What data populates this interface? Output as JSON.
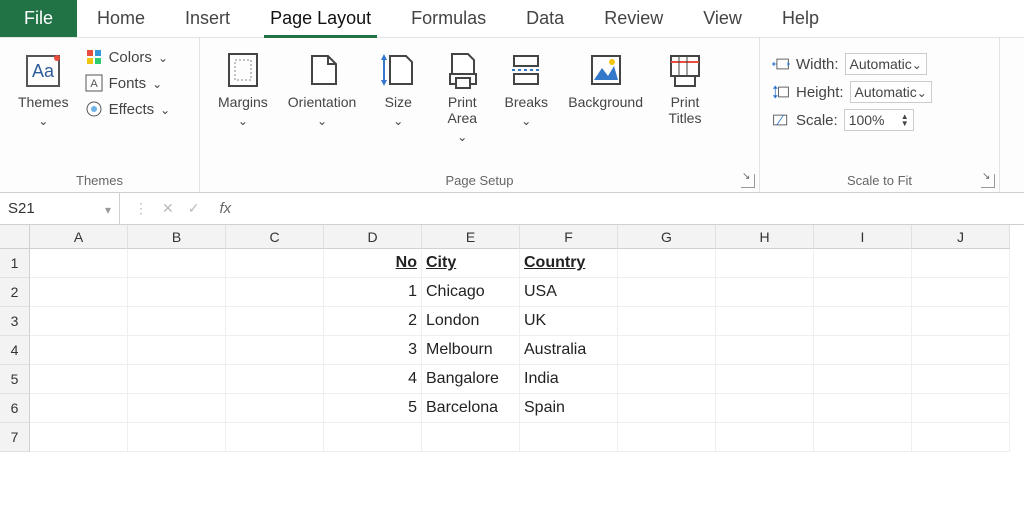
{
  "tabs": {
    "file": "File",
    "items": [
      "Home",
      "Insert",
      "Page Layout",
      "Formulas",
      "Data",
      "Review",
      "View",
      "Help"
    ],
    "activeIndex": 2
  },
  "ribbon": {
    "themes": {
      "label": "Themes",
      "themesBtn": "Themes",
      "colors": "Colors",
      "fonts": "Fonts",
      "effects": "Effects"
    },
    "pageSetup": {
      "label": "Page Setup",
      "margins": "Margins",
      "orientation": "Orientation",
      "size": "Size",
      "printArea": "Print\nArea",
      "breaks": "Breaks",
      "background": "Background",
      "printTitles": "Print\nTitles"
    },
    "scaleToFit": {
      "label": "Scale to Fit",
      "width": "Width:",
      "widthVal": "Automatic",
      "height": "Height:",
      "heightVal": "Automatic",
      "scale": "Scale:",
      "scaleVal": "100%"
    }
  },
  "formulaBar": {
    "nameBox": "S21",
    "fx": "fx",
    "formula": ""
  },
  "sheet": {
    "columns": [
      "A",
      "B",
      "C",
      "D",
      "E",
      "F",
      "G",
      "H",
      "I",
      "J"
    ],
    "rowCount": 7,
    "headers": {
      "no": "No",
      "city": "City",
      "country": "Country"
    },
    "data": [
      {
        "no": "1",
        "city": "Chicago",
        "country": "USA"
      },
      {
        "no": "2",
        "city": "London",
        "country": "UK"
      },
      {
        "no": "3",
        "city": "Melbourn",
        "country": "Australia"
      },
      {
        "no": "4",
        "city": "Bangalore",
        "country": "India"
      },
      {
        "no": "5",
        "city": "Barcelona",
        "country": "Spain"
      }
    ]
  }
}
